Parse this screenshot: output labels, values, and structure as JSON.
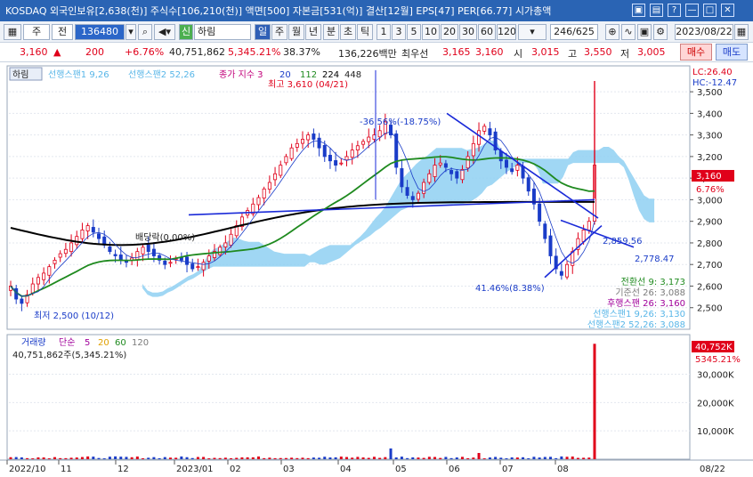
{
  "titlebar": {
    "text": "KOSDAQ 외국인보유[2,638(천)] 주식수[106,210(천)] 액면[500] 자본금[531(억)] 결산[12월] EPS[47] PER[66.77] 시가총액",
    "buttons": [
      "▣",
      "▤",
      "?",
      "—",
      "□",
      "✕"
    ]
  },
  "toolbar": {
    "type_select": "주",
    "market_label": "전",
    "code_value": "136480",
    "stock_name": "하림",
    "period_buttons": [
      "일",
      "주",
      "월",
      "년",
      "분",
      "초",
      "틱"
    ],
    "minute_buttons": [
      "1",
      "3",
      "5",
      "10",
      "20",
      "30",
      "60",
      "120"
    ],
    "page_counter": "246/625",
    "date_value": "2023/08/22"
  },
  "inforow": {
    "price": "3,160",
    "change": "200",
    "change_pct": "+6.76%",
    "volume": "40,751,862",
    "volume_ratio": "5,345.21%",
    "turnover": "38.37%",
    "amount": "136,226백만",
    "ask_label": "최우선",
    "ask": "3,165",
    "bid": "3,160",
    "open_label": "시",
    "open": "3,015",
    "high_label": "고",
    "high": "3,550",
    "low_label": "저",
    "low": "3,005",
    "buy_button": "매수",
    "sell_button": "매도"
  },
  "colors": {
    "up": "#e0001a",
    "down": "#1a3cc8",
    "cloud": "#8fd0f2",
    "ma_black": "#000000",
    "ma_green": "#1f8a1f",
    "trend": "#1a2ad8"
  },
  "chart_data": [
    {
      "type": "candlestick",
      "stock": "하림",
      "legend": [
        "선행스팬1 9,26",
        "선행스팬2 52,26",
        "종가 지수 3",
        "20",
        "112",
        "224",
        "448"
      ],
      "ylim": [
        2400,
        3620
      ],
      "y_ticks": [
        2500,
        2600,
        2700,
        2800,
        2900,
        3000,
        3100,
        3200,
        3300,
        3400,
        3500
      ],
      "y_tick_labels": [
        "2,500",
        "2,600",
        "2,700",
        "2,800",
        "2,900",
        "3,000",
        "3,100",
        "3,200",
        "3,300",
        "3,400",
        "3,500"
      ],
      "x_labels": [
        "2022/10",
        "11",
        "12",
        "2023/01",
        "02",
        "03",
        "04",
        "05",
        "06",
        "07",
        "08"
      ],
      "x_date_label": "08/22",
      "close_series": [
        2600,
        2540,
        2520,
        2560,
        2610,
        2640,
        2660,
        2690,
        2720,
        2750,
        2770,
        2800,
        2830,
        2860,
        2880,
        2850,
        2820,
        2790,
        2760,
        2740,
        2720,
        2710,
        2730,
        2760,
        2780,
        2760,
        2740,
        2720,
        2700,
        2710,
        2730,
        2720,
        2700,
        2680,
        2690,
        2710,
        2740,
        2760,
        2780,
        2800,
        2840,
        2880,
        2920,
        2950,
        2980,
        3010,
        3050,
        3080,
        3120,
        3160,
        3200,
        3240,
        3260,
        3280,
        3300,
        3280,
        3240,
        3200,
        3180,
        3160,
        3170,
        3200,
        3230,
        3250,
        3270,
        3290,
        3300,
        3320,
        3360,
        3300,
        3150,
        3060,
        3020,
        3000,
        3030,
        3080,
        3120,
        3160,
        3170,
        3150,
        3120,
        3100,
        3140,
        3200,
        3260,
        3320,
        3340,
        3300,
        3230,
        3180,
        3150,
        3130,
        3160,
        3100,
        3040,
        2980,
        2900,
        2820,
        2740,
        2680,
        2650,
        2700,
        2760,
        2820,
        2860,
        2900,
        3160
      ],
      "high_label": "최고 3,610 (04/21)",
      "low_label": "최저 2,500 (10/12)",
      "dividend_label": "배당락(0.00%)",
      "annotations": [
        "-36.56%(-18.75%)",
        "41.46%(8.38%)",
        "2,859.56",
        "2,778.47"
      ],
      "last_price": "3,160",
      "last_pct": "6.76%",
      "lc": "LC:26.40",
      "hc": "HC:-12.47",
      "ichimoku_values": [
        {
          "label": "전환선 9: 3,173"
        },
        {
          "label": "기준선 26: 3,088"
        },
        {
          "label": "후행스팬 26: 3,160"
        },
        {
          "label": "선행스팬1 9,26: 3,130"
        },
        {
          "label": "선행스팬2 52,26: 3,088"
        }
      ]
    },
    {
      "type": "bar",
      "title": "거래량",
      "legend": [
        "단순",
        "5",
        "20",
        "60",
        "120"
      ],
      "volume_text": "40,751,862주(5,345.21%)",
      "y_ticks": [
        10000,
        20000,
        30000
      ],
      "y_tick_labels": [
        "10,000K",
        "20,000K",
        "30,000K"
      ],
      "last_volume": "40,752K",
      "last_volume_pct": "5345.21%",
      "ylim": [
        0,
        44000
      ]
    }
  ]
}
